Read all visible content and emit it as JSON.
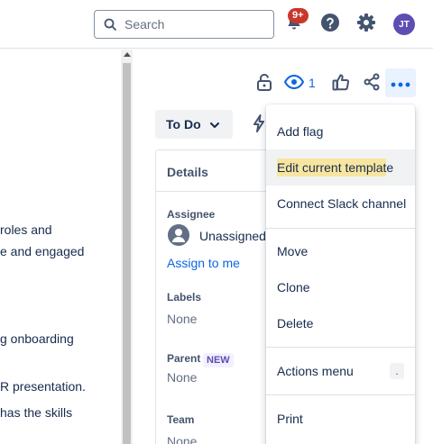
{
  "topnav": {
    "search_placeholder": "Search",
    "notifications_badge": "9+",
    "avatar_initials": "JT"
  },
  "description": {
    "lines": [
      "roles and",
      "e and engaged",
      "g onboarding",
      "R presentation.",
      "has the skills"
    ]
  },
  "toolbar": {
    "watch_count": "1"
  },
  "status": {
    "label": "To Do"
  },
  "details": {
    "title": "Details",
    "assignee_label": "Assignee",
    "assignee_value": "Unassigned",
    "assign_to_me": "Assign to me",
    "labels_label": "Labels",
    "labels_value": "None",
    "parent_label": "Parent",
    "parent_badge": "NEW",
    "parent_value": "None",
    "team_label": "Team",
    "team_value": "None"
  },
  "menu": {
    "items": [
      {
        "label": "Add flag"
      },
      {
        "label": "Edit current template",
        "highlighted": "Edit current templat",
        "rest": "e"
      },
      {
        "label": "Connect Slack channel"
      },
      {
        "label": "Move"
      },
      {
        "label": "Clone"
      },
      {
        "label": "Delete"
      },
      {
        "label": "Actions menu",
        "shortcut": "."
      },
      {
        "label": "Print"
      }
    ]
  },
  "colors": {
    "brand_blue": "#0c66e4",
    "badge_red": "#c9372c",
    "avatar_purple": "#5e4db2",
    "highlight_yellow": "#f8e6a0"
  }
}
